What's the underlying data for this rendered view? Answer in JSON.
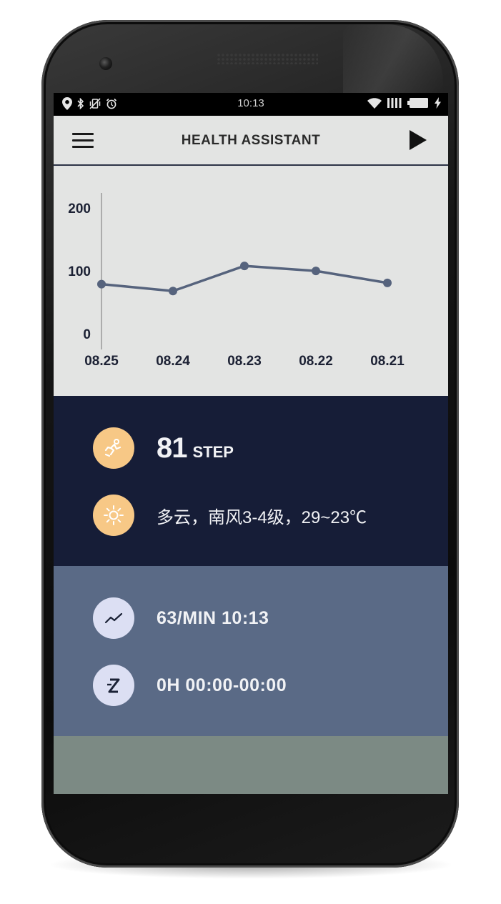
{
  "status_bar": {
    "time": "10:13",
    "left_icons": [
      "location-icon",
      "bluetooth-icon",
      "vibrate-off-icon",
      "alarm-icon"
    ],
    "right_icons": [
      "wifi-icon",
      "signal-icon",
      "battery-icon",
      "charging-icon"
    ]
  },
  "app_bar": {
    "title": "HEALTH ASSISTANT",
    "menu_icon": "menu-icon",
    "action_icon": "play-icon"
  },
  "chart_data": {
    "type": "line",
    "categories": [
      "08.25",
      "08.24",
      "08.23",
      "08.22",
      "08.21"
    ],
    "values": [
      80,
      69,
      109,
      101,
      82
    ],
    "ylim": [
      0,
      200
    ],
    "y_ticks": [
      "200",
      "100",
      "0"
    ],
    "color": "#56637d",
    "title": "",
    "xlabel": "",
    "ylabel": "",
    "grid": false
  },
  "steps": {
    "icon": "running-person-icon",
    "value": "81",
    "unit": "STEP"
  },
  "weather": {
    "icon": "sun-icon",
    "text": "多云，南风3-4级，29~23℃"
  },
  "heart_rate": {
    "icon": "trend-line-icon",
    "text": "63/MIN 10:13"
  },
  "sleep": {
    "icon": "sleep-z-icon",
    "text": "0H 00:00-00:00"
  },
  "colors": {
    "accent_orange": "#f7c886",
    "dark_panel": "#161d37",
    "mid_panel": "#5a6a86",
    "bottom_panel": "#7c8a84",
    "chart_bg": "#e3e4e3"
  }
}
